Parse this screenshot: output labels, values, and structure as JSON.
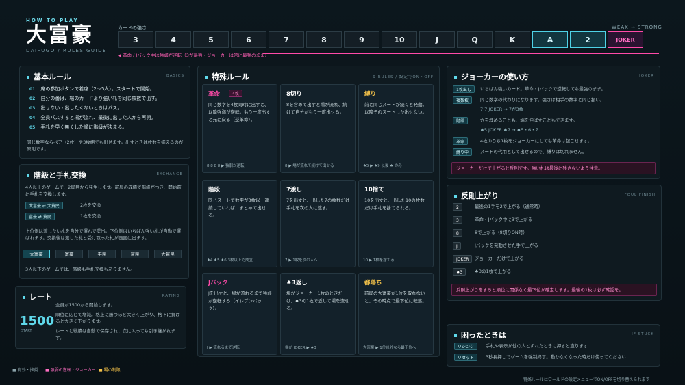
{
  "header": {
    "howto": "HOW TO PLAY",
    "title": "大富豪",
    "subtitle": "DAIFUGO / RULES GUIDE",
    "strength_label": "カードの強さ",
    "weak_strong": "WEAK → STRONG",
    "cards": [
      "3",
      "4",
      "5",
      "6",
      "7",
      "8",
      "9",
      "10",
      "J",
      "Q",
      "K",
      "A",
      "2",
      "JOKER"
    ],
    "revolution_note": "◀ 革命 / Jバック中は強弱が逆転（3が最強・ジョーカーは常に最強のまま）"
  },
  "basic": {
    "title": "基本ルール",
    "tag": "BASICS",
    "rules": [
      {
        "n": "01",
        "t": "席の参加ボタンで着席（2〜5人）。スタートで開始。"
      },
      {
        "n": "02",
        "t": "自分の番は、場のカードより強い札を同じ枚数で出す。"
      },
      {
        "n": "03",
        "t": "出せない・出したくないときはパス。"
      },
      {
        "n": "04",
        "t": "全員パスすると場が流れ、最後に出した人から再開。"
      },
      {
        "n": "05",
        "t": "手札を早く無くした順に階級が決まる。"
      }
    ],
    "note": "同じ数字ならペア（2枚）や3枚組でも出せます。出すときは枚数を揃えるのが原則です。"
  },
  "exchange": {
    "title": "階級と手札交換",
    "tag": "EXCHANGE",
    "desc": "4人以上のゲームで、2局目から発生します。前局の成績で階級がつき、開始前に手札を交換します。",
    "rows": [
      {
        "chip": "大富豪 ⇄ 大貧民",
        "text": "2枚を交換"
      },
      {
        "chip": "富豪 ⇄ 貧民",
        "text": "1枚を交換"
      }
    ],
    "note": "上位側は渡したい札を自分で選んで提出。下位側はいちばん強い札が自動で選ばれます。交換後は渡した札と受け取った札が画面に出ます。",
    "ranks": [
      "大富豪",
      "富豪",
      "平民",
      "貧民",
      "大貧民"
    ],
    "footnote": "3人以下のゲームでは、階級も手札交換もありません。"
  },
  "rating": {
    "title": "レート",
    "tag": "RATING",
    "value": "1500",
    "start": "START",
    "items": [
      "全員が1500から開始します。",
      "順位に応じて増減。格上に勝つほど大きく上がり、格下に負けると大きく下がります。",
      "レートと戦績は自動で保存され、次に入っても引き継がれます。"
    ]
  },
  "special": {
    "title": "特殊ルール",
    "tag": "9 RULES / 設定でON・OFF",
    "cards": [
      {
        "t": "革命",
        "badge": "4枚",
        "d": "同じ数字を4枚同時に出すと、以降強弱が逆転。もう一度出すと元に戻る（逆革命）。",
        "f": "8 8 8 8 ▶ 強弱が逆転",
        "c": "#ff4aa8"
      },
      {
        "t": "8切り",
        "badge": "",
        "d": "8を含めて出すと場が流れ、続けて自分がもう一度出せる。",
        "f": "8 ▶ 場が流れて続けて出せる",
        "c": "#fff"
      },
      {
        "t": "縛り",
        "badge": "",
        "d": "前と同じスートが続くと発動。以降そのスートしか出せない。",
        "f": "♠5 ▶ ♠9 以後 ♠ のみ",
        "c": "#f5c34a"
      },
      {
        "t": "階段",
        "badge": "",
        "d": "同じスートで数字が3枚以上連続していれば、まとめて出せる。",
        "f": "♦4 ♦5 ♦6 3枚以上で成立",
        "c": "#fff"
      },
      {
        "t": "7渡し",
        "badge": "",
        "d": "7を出すと、出した7の枚数だけ手札を次の人に渡す。",
        "f": "7 ▶ 1枚を次の人へ",
        "c": "#fff"
      },
      {
        "t": "10捨て",
        "badge": "",
        "d": "10を出すと、出した10の枚数だけ手札を捨てられる。",
        "f": "10 ▶ 1枚を捨てる",
        "c": "#fff"
      },
      {
        "t": "Jバック",
        "badge": "",
        "d": "Jを出すと、場が流れるまで強弱が逆転する（イレブンバック）。",
        "f": "J ▶ 流れるまで逆転",
        "c": "#ff4aa8"
      },
      {
        "t": "♠3返し",
        "badge": "",
        "d": "場がジョーカー1枚のときだけ、♠3の1枚で返して場を流せる。",
        "f": "場が JOKER ▶ ♠3",
        "c": "#fff"
      },
      {
        "t": "都落ち",
        "badge": "",
        "d": "前局の大富豪が1位を取れないと、その時点で最下位に転落。",
        "f": "大富豪 ▶ 1位以外なら最下位へ",
        "c": "#f5c34a"
      }
    ]
  },
  "joker": {
    "title": "ジョーカーの使い方",
    "tag": "JOKER",
    "rows": [
      {
        "chip": "1枚出し",
        "t": "いちばん強いカード。革命・Jバックで逆転しても最強のまま。"
      },
      {
        "chip": "複数枚",
        "t": "同じ数字の代わりになります。強さは相手の数字と同じ扱い。"
      },
      {
        "chip": "",
        "t": "7 7 JOKER → 7が3枚"
      },
      {
        "chip": "階段",
        "t": "穴を埋めることも、端を伸ばすこともできます。"
      },
      {
        "chip": "",
        "t": "♠5 JOKER ♠7 → ♠5・6・7"
      },
      {
        "chip": "革命",
        "t": "4枚のうち1枚をジョーカーにしても革命は起こせます。"
      },
      {
        "chip": "縛り中",
        "t": "スートの代用として出せるので、縛りは切れません。"
      }
    ],
    "warn": "ジョーカーだけで上がると反則です。強い札は最後に残さないよう注意。"
  },
  "foul": {
    "title": "反則上がり",
    "tag": "FOUL FINISH",
    "rows": [
      {
        "k": "2",
        "t": "最後の1手を2で上がる（通常時）"
      },
      {
        "k": "3",
        "t": "革命・Jバック中に3で上がる"
      },
      {
        "k": "8",
        "t": "8で上がる（8切りON時）"
      },
      {
        "k": "J",
        "t": "Jバックを発動させた手で上がる"
      },
      {
        "k": "JOKER",
        "t": "ジョーカーだけで上がる"
      },
      {
        "k": "♠3",
        "t": "♠3の1枚で上がる"
      }
    ],
    "warn": "反則上がりをすると順位に関係なく最下位が確定します。最後の1枚は必ず確認を。"
  },
  "stuck": {
    "title": "困ったときは",
    "tag": "IF STUCK",
    "rows": [
      {
        "chip": "リシンク",
        "t": "手札や表示が他の人とずれたときに押すと直ります"
      },
      {
        "chip": "リセット",
        "t": "3秒長押しでゲームを強制終了。動かなくなった時だけ使ってください"
      }
    ]
  },
  "footer": {
    "legend": [
      "■ 有効・推奨",
      "■ 強弱の逆転・ジョーカー",
      "■ 場の制限"
    ],
    "note": "特殊ルールはワールドの設定メニューでON/OFFを切り替えられます"
  },
  "colors": {
    "accent": "#5fd8ea",
    "pink": "#ff4aa8",
    "gold": "#f5c34a"
  }
}
